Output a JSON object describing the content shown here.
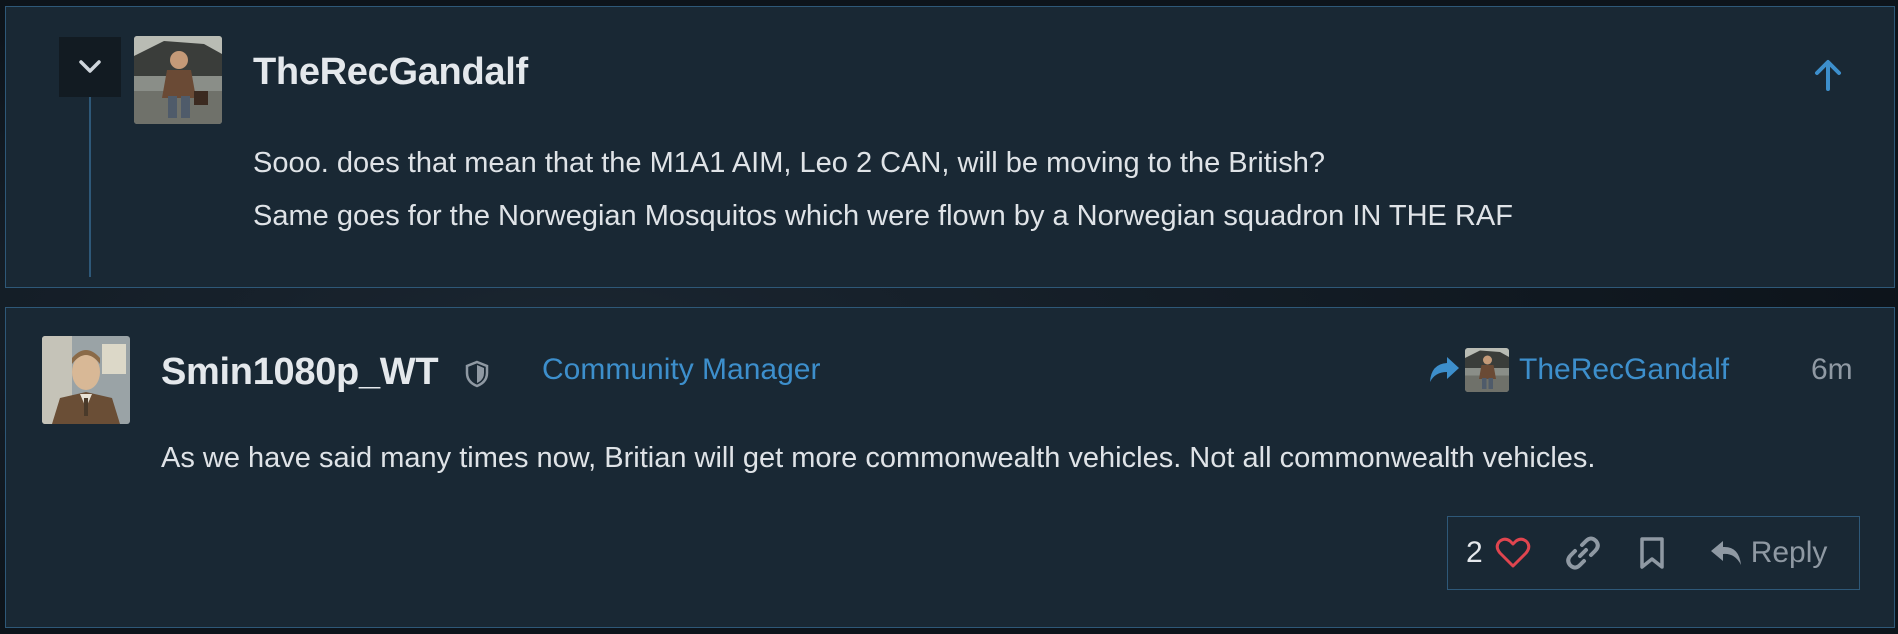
{
  "quoted_post": {
    "username": "TheRecGandalf",
    "lines": [
      "Sooo. does that mean that the M1A1 AIM, Leo 2 CAN, will be moving to the British?",
      "Same goes for the Norwegian Mosquitos which were flown by a Norwegian squadron IN THE RAF"
    ],
    "collapse_icon": "chevron-down-icon",
    "jump_icon": "arrow-up-icon"
  },
  "reply_post": {
    "username": "Smin1080p_WT",
    "role_icon": "shield-icon",
    "role": "Community Manager",
    "reply_to_icon": "share-arrow-icon",
    "reply_to_name": "TheRecGandalf",
    "time": "6m",
    "body": "As we have said many times now, Britian will get more commonwealth vehicles. Not all commonwealth vehicles.",
    "actions": {
      "like_count": "2",
      "like_icon": "heart-icon",
      "link_icon": "link-icon",
      "bookmark_icon": "bookmark-icon",
      "reply_icon": "reply-icon",
      "reply_label": "Reply"
    }
  },
  "colors": {
    "card_bg": "#192834",
    "border": "#2e5878",
    "accent": "#3d8fcc",
    "heart": "#e0454f",
    "muted": "#8f99a3"
  }
}
